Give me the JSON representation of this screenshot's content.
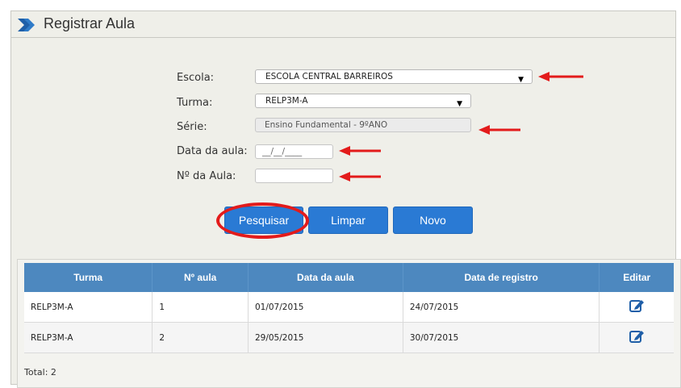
{
  "page": {
    "title": "Registrar Aula",
    "header_icon": "chevron-right-icon"
  },
  "form": {
    "escola": {
      "label": "Escola:",
      "value": "ESCOLA CENTRAL BARREIROS"
    },
    "turma": {
      "label": "Turma:",
      "value": "RELP3M-A"
    },
    "serie": {
      "label": "Série:",
      "value": "Ensino Fundamental - 9ºANO"
    },
    "data_aula": {
      "label": "Data da aula:",
      "placeholder": "__/__/____"
    },
    "numero_aula": {
      "label": "Nº da Aula:",
      "value": ""
    }
  },
  "buttons": {
    "pesquisar": "Pesquisar",
    "limpar": "Limpar",
    "novo": "Novo"
  },
  "table": {
    "columns": [
      "Turma",
      "Nº aula",
      "Data da aula",
      "Data de registro",
      "Editar"
    ],
    "rows": [
      {
        "turma": "RELP3M-A",
        "numero": "1",
        "data_aula": "01/07/2015",
        "data_registro": "24/07/2015",
        "edit_icon": "edit-icon"
      },
      {
        "turma": "RELP3M-A",
        "numero": "2",
        "data_aula": "29/05/2015",
        "data_registro": "30/07/2015",
        "edit_icon": "edit-icon"
      }
    ]
  },
  "footer": {
    "total": "Total: 2"
  },
  "colors": {
    "accent": "#2a7ad4",
    "table_header": "#4d88bf",
    "annotation": "#e31b1b",
    "panel_bg": "#efefe9"
  }
}
